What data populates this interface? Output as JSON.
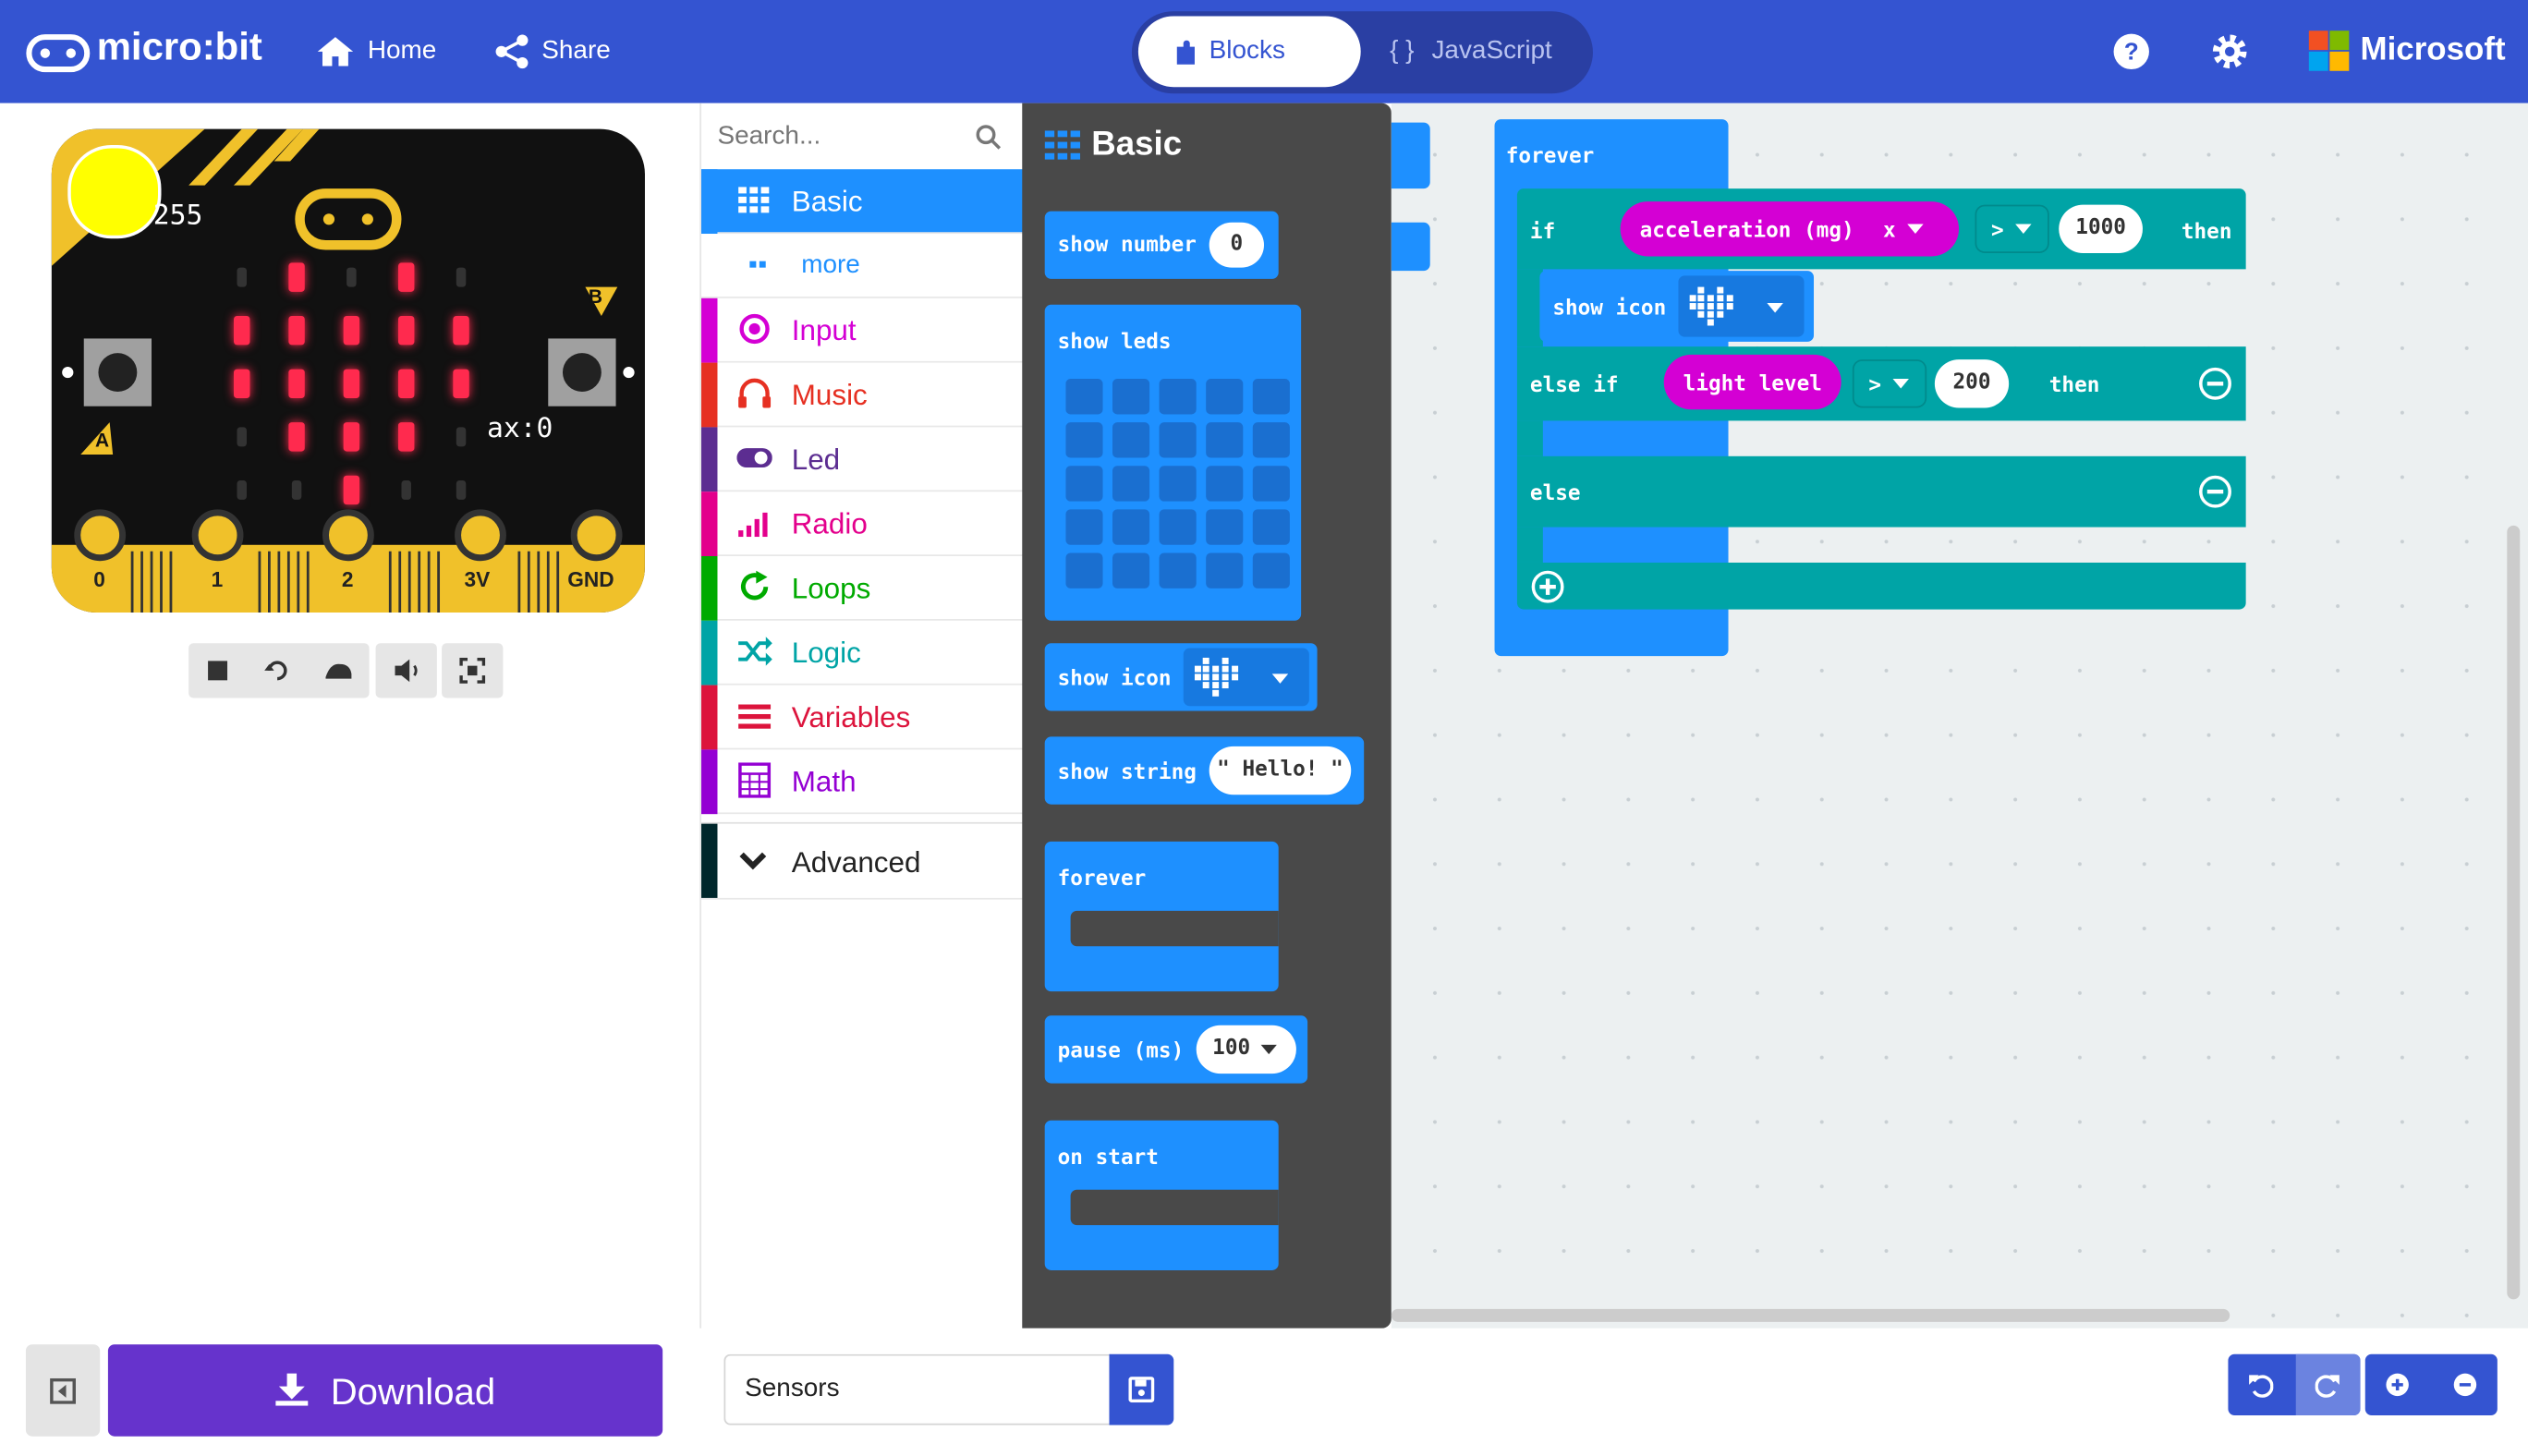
{
  "header": {
    "logo_text": "micro:bit",
    "nav": {
      "home": "Home",
      "share": "Share"
    },
    "tabs": {
      "blocks": "Blocks",
      "javascript_braces": "{ }",
      "javascript": "JavaScript"
    },
    "brand": "Microsoft",
    "icons": [
      "microbit-logo-icon",
      "home-icon",
      "share-icon",
      "puzzle-icon",
      "help-icon",
      "gear-icon",
      "microsoft-logo"
    ]
  },
  "simulator": {
    "light_level": "255",
    "accel_readout": "ax:0",
    "buttons": {
      "a": "A",
      "b": "B"
    },
    "pins": [
      "0",
      "1",
      "2",
      "3V",
      "GND"
    ],
    "led_matrix": [
      [
        0,
        1,
        0,
        1,
        0
      ],
      [
        1,
        1,
        1,
        1,
        1
      ],
      [
        1,
        1,
        1,
        1,
        1
      ],
      [
        0,
        1,
        1,
        1,
        0
      ],
      [
        0,
        0,
        1,
        0,
        0
      ]
    ],
    "controls": [
      "stop-icon",
      "restart-icon",
      "slowmo-icon",
      "mute-icon",
      "fullscreen-icon"
    ],
    "colors": {
      "led_on": "#ff2a4e",
      "board": "#111111",
      "edge": "#f0c12a",
      "light_sun": "#ffff00"
    }
  },
  "toolbox": {
    "search_placeholder": "Search...",
    "categories": [
      {
        "label": "Basic",
        "color": "#1e90ff",
        "icon": "grid-icon",
        "selected": true
      },
      {
        "label": "more",
        "color": "#1e90ff",
        "icon": "ellipsis-icon",
        "sub": true
      },
      {
        "label": "Input",
        "color": "#d400d4",
        "icon": "input-icon"
      },
      {
        "label": "Music",
        "color": "#e63022",
        "icon": "headphones-icon"
      },
      {
        "label": "Led",
        "color": "#5c2d91",
        "icon": "toggle-icon"
      },
      {
        "label": "Radio",
        "color": "#e3008c",
        "icon": "signal-icon"
      },
      {
        "label": "Loops",
        "color": "#00aa00",
        "icon": "loop-icon"
      },
      {
        "label": "Logic",
        "color": "#00a4a6",
        "icon": "shuffle-icon"
      },
      {
        "label": "Variables",
        "color": "#dc143c",
        "icon": "list-icon"
      },
      {
        "label": "Math",
        "color": "#9400d3",
        "icon": "calculator-icon"
      }
    ],
    "advanced": "Advanced"
  },
  "flyout": {
    "title": "Basic",
    "blocks": {
      "show_number": "show number",
      "show_number_value": "0",
      "show_leds": "show leds",
      "show_icon": "show icon",
      "show_string": "show string",
      "show_string_value": "\" Hello! \"",
      "forever": "forever",
      "pause": "pause (ms)",
      "pause_value": "100",
      "on_start": "on start"
    }
  },
  "workspace": {
    "forever": "forever",
    "if": "if",
    "acceleration": "acceleration (mg)",
    "axis": "x",
    "op1": ">",
    "threshold1": "1000",
    "then": "then",
    "show_icon": "show icon",
    "else_if": "else if",
    "light_level": "light level",
    "op2": ">",
    "threshold2": "200",
    "else": "else"
  },
  "footer": {
    "download": "Download",
    "project_name": "Sensors",
    "icons": [
      "collapse-icon",
      "download-icon",
      "save-icon",
      "undo-icon",
      "redo-icon",
      "zoom-in-icon",
      "zoom-out-icon"
    ]
  }
}
